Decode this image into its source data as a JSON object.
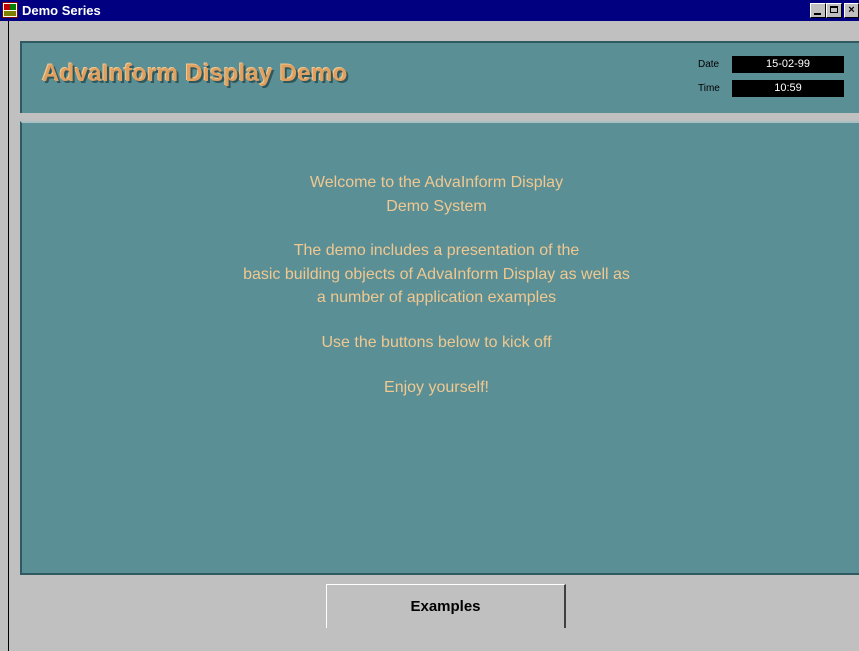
{
  "window": {
    "title": "Demo Series",
    "controls": {
      "minimize": "minimize-button",
      "maximize": "maximize-button",
      "close_label": "×"
    }
  },
  "header": {
    "app_title": "AdvaInform Display Demo",
    "date_label": "Date",
    "date_value": "15-02-99",
    "time_label": "Time",
    "time_value": "10:59"
  },
  "welcome": {
    "line1": "Welcome to the AdvaInform Display",
    "line2": "Demo System",
    "line3": "The demo includes a presentation of the",
    "line4": "basic building objects of AdvaInform Display as well as",
    "line5": "a number of application examples",
    "line6": "Use the buttons below to kick off",
    "line7": "Enjoy yourself!"
  },
  "tabs": [
    {
      "label": "Examples"
    }
  ],
  "colors": {
    "panel_bg": "#5a8f96",
    "title_text": "#e0a060",
    "message_text": "#f0c890",
    "titlebar_bg": "#000080"
  }
}
